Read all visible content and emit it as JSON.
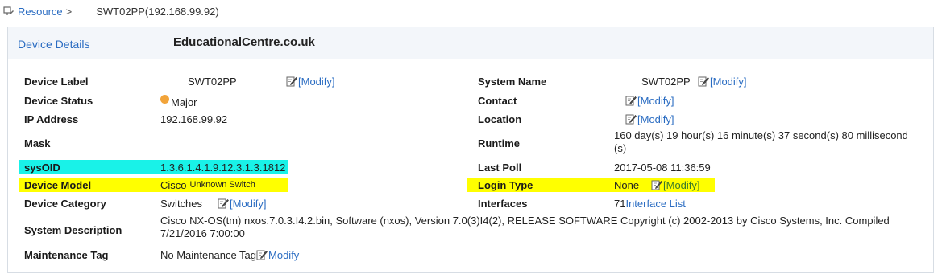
{
  "breadcrumb": {
    "resource": "Resource",
    "separator": ">",
    "current": "SWT02PP(192.168.99.92)"
  },
  "panel": {
    "tab_label": "Device Details",
    "watermark": "EducationalCentre.co.uk"
  },
  "modify_bracket": "[Modify]",
  "modify_plain": "Modify",
  "left": {
    "device_label": {
      "label": "Device Label",
      "value": "SWT02PP"
    },
    "device_status": {
      "label": "Device Status",
      "value": "Major",
      "status_color": "#f2a43a"
    },
    "ip_address": {
      "label": "IP Address",
      "value": "192.168.99.92"
    },
    "mask": {
      "label": "Mask",
      "value": ""
    },
    "sysoid": {
      "label": "sysOID",
      "value": "1.3.6.1.4.1.9.12.3.1.3.1812"
    },
    "device_model": {
      "label": "Device Model",
      "value": "Cisco",
      "sub_value": "Unknown Switch"
    },
    "device_category": {
      "label": "Device Category",
      "value": "Switches"
    }
  },
  "right": {
    "system_name": {
      "label": "System Name",
      "value": "SWT02PP"
    },
    "contact": {
      "label": "Contact",
      "value": ""
    },
    "location": {
      "label": "Location",
      "value": ""
    },
    "runtime": {
      "label": "Runtime",
      "value_line1": "160 day(s) 19 hour(s) 16 minute(s) 37 second(s) 80 millisecond",
      "value_line2": "(s)"
    },
    "last_poll": {
      "label": "Last Poll",
      "value": "2017-05-08 11:36:59"
    },
    "login_type": {
      "label": "Login Type",
      "value": "None"
    },
    "interfaces": {
      "label": "Interfaces",
      "count": "71",
      "link": "Interface List"
    }
  },
  "system_description": {
    "label": "System Description",
    "line1": "Cisco NX-OS(tm) nxos.7.0.3.I4.2.bin, Software (nxos), Version 7.0(3)I4(2), RELEASE SOFTWARE Copyright (c) 2002-2013 by Cisco Systems, Inc. Compiled",
    "line2": "7/21/2016 7:00:00"
  },
  "maintenance_tag": {
    "label": "Maintenance Tag",
    "value": "No Maintenance Tag"
  },
  "highlight_colors": {
    "cyan": "#19f2e8",
    "yellow": "#ffff00"
  }
}
